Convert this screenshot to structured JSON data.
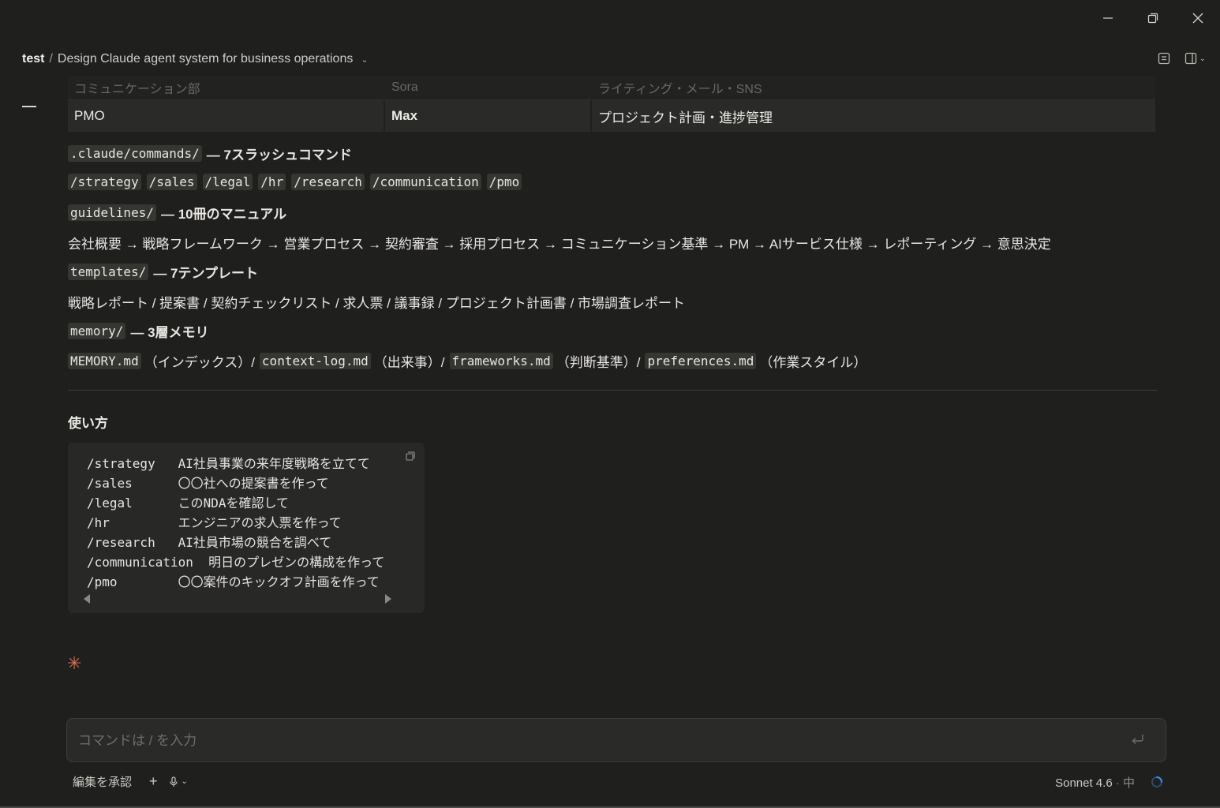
{
  "header": {
    "project": "test",
    "separator": "/",
    "conversation_title": "Design Claude agent system for business operations"
  },
  "table": {
    "faded_row": [
      "コミュニケーション部",
      "Sora",
      "ライティング・メール・SNS"
    ],
    "pmo_row": [
      "PMO",
      "Max",
      "プロジェクト計画・進捗管理"
    ]
  },
  "content": {
    "commands_heading_code": ".claude/commands/",
    "commands_heading_text": "— 7スラッシュコマンド",
    "commands": [
      "/strategy",
      "/sales",
      "/legal",
      "/hr",
      "/research",
      "/communication",
      "/pmo"
    ],
    "guidelines_heading_code": "guidelines/",
    "guidelines_heading_text": "— 10冊のマニュアル",
    "guidelines_chain": "会社概要 → 戦略フレームワーク → 営業プロセス → 契約審査 → 採用プロセス → コミュニケーション基準 → PM → AIサービス仕様 → レポーティング → 意思決定",
    "templates_heading_code": "templates/",
    "templates_heading_text": "— 7テンプレート",
    "templates_list": "戦略レポート / 提案書 / 契約チェックリスト / 求人票 / 議事録 / プロジェクト計画書 / 市場調査レポート",
    "memory_heading_code": "memory/",
    "memory_heading_text": "— 3層メモリ",
    "memory_files": [
      {
        "file": "MEMORY.md",
        "desc": "（インデックス）/"
      },
      {
        "file": "context-log.md",
        "desc": "（出来事）/"
      },
      {
        "file": "frameworks.md",
        "desc": "（判断基準）/"
      },
      {
        "file": "preferences.md",
        "desc": "（作業スタイル）"
      }
    ],
    "usage_heading": "使い方",
    "usage_code": "/strategy   AI社員事業の来年度戦略を立てて\n/sales      〇〇社への提案書を作って\n/legal      このNDAを確認して\n/hr         エンジニアの求人票を作って\n/research   AI社員市場の競合を調べて\n/communication  明日のプレゼンの構成を作って\n/pmo        〇〇案件のキックオフ計画を作って"
  },
  "input": {
    "placeholder": "コマンドは / を入力",
    "value": ""
  },
  "bottom": {
    "accept_edits": "編集を承認",
    "add": "+",
    "model": "Sonnet 4.6",
    "effort": "· 中"
  },
  "icons": [
    "minimize-icon",
    "restore-icon",
    "close-icon",
    "chevron-down-icon",
    "notes-icon",
    "sidebar-toggle-icon",
    "copy-icon",
    "sparkle-icon",
    "enter-icon",
    "microphone-icon",
    "loading-spinner-icon"
  ],
  "colors": {
    "background": "#1f1f1e",
    "accent": "#d9704f",
    "spinner": "#3b8ef0"
  }
}
